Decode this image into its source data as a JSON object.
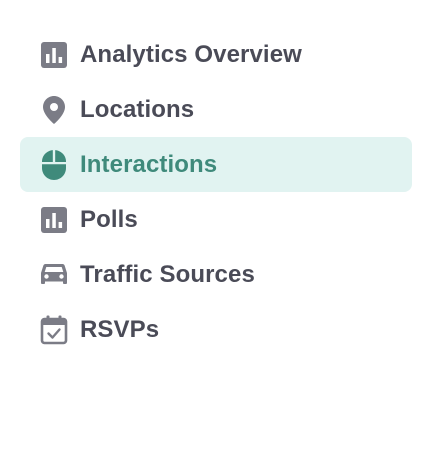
{
  "colors": {
    "text": "#4a4b57",
    "icon": "#7b7c86",
    "active_text": "#3f8a7b",
    "active_bg": "#e1f3f1"
  },
  "nav": {
    "items": [
      {
        "label": "Analytics Overview",
        "icon": "bar-chart-icon",
        "active": false
      },
      {
        "label": "Locations",
        "icon": "location-pin-icon",
        "active": false
      },
      {
        "label": "Interactions",
        "icon": "mouse-icon",
        "active": true
      },
      {
        "label": "Polls",
        "icon": "bar-chart-icon",
        "active": false
      },
      {
        "label": "Traffic Sources",
        "icon": "car-icon",
        "active": false
      },
      {
        "label": "RSVPs",
        "icon": "calendar-check-icon",
        "active": false
      }
    ]
  }
}
